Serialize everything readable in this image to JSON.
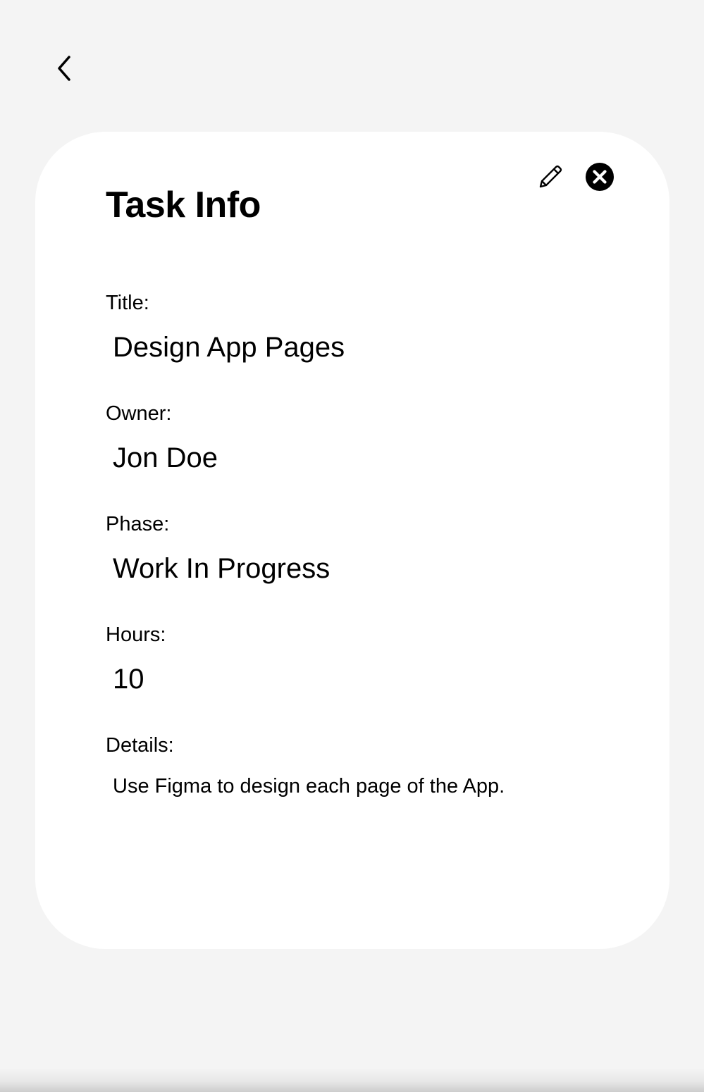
{
  "nav": {
    "back_icon": "chevron-left-icon"
  },
  "card": {
    "title": "Task Info",
    "actions": {
      "edit_icon": "pencil-icon",
      "close_icon": "close-circle-icon"
    },
    "fields": {
      "title": {
        "label": "Title:",
        "value": "Design App Pages"
      },
      "owner": {
        "label": "Owner:",
        "value": "Jon Doe"
      },
      "phase": {
        "label": "Phase:",
        "value": "Work In Progress"
      },
      "hours": {
        "label": "Hours:",
        "value": "10"
      },
      "details": {
        "label": "Details:",
        "value": "Use Figma to design each page of the App."
      }
    }
  },
  "colors": {
    "page_background": "#f4f4f4",
    "card_background": "#ffffff",
    "text": "#000000"
  }
}
